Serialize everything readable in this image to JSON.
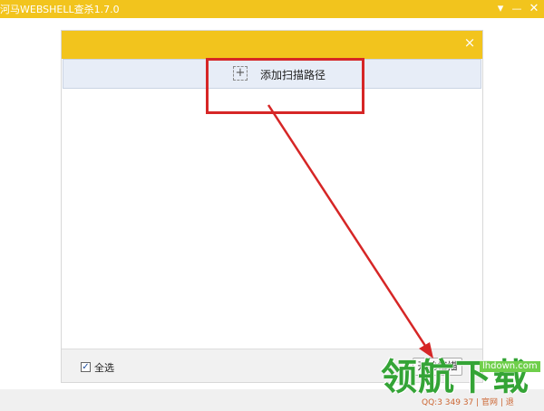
{
  "window": {
    "title": "河马WEBSHELL查杀1.7.0",
    "controls": {
      "menu": "▾",
      "minimize": "—",
      "close": "✕"
    }
  },
  "dialog": {
    "close": "×",
    "add_path_icon": "+",
    "add_path_label": "添加扫描路径",
    "select_all_checked": "✓",
    "select_all_label": "全选",
    "start_scan_button": "开始扫描"
  },
  "status_bar": {
    "contact": "QQ:3  349 37 | 官网 | 退"
  },
  "overlay": {
    "annotation_color": "#d62626",
    "watermark": {
      "brand": "领航下载",
      "url": "lhdown.com"
    }
  },
  "colors": {
    "brand": "#f2c41d",
    "row_highlight": "#e7edf7"
  }
}
